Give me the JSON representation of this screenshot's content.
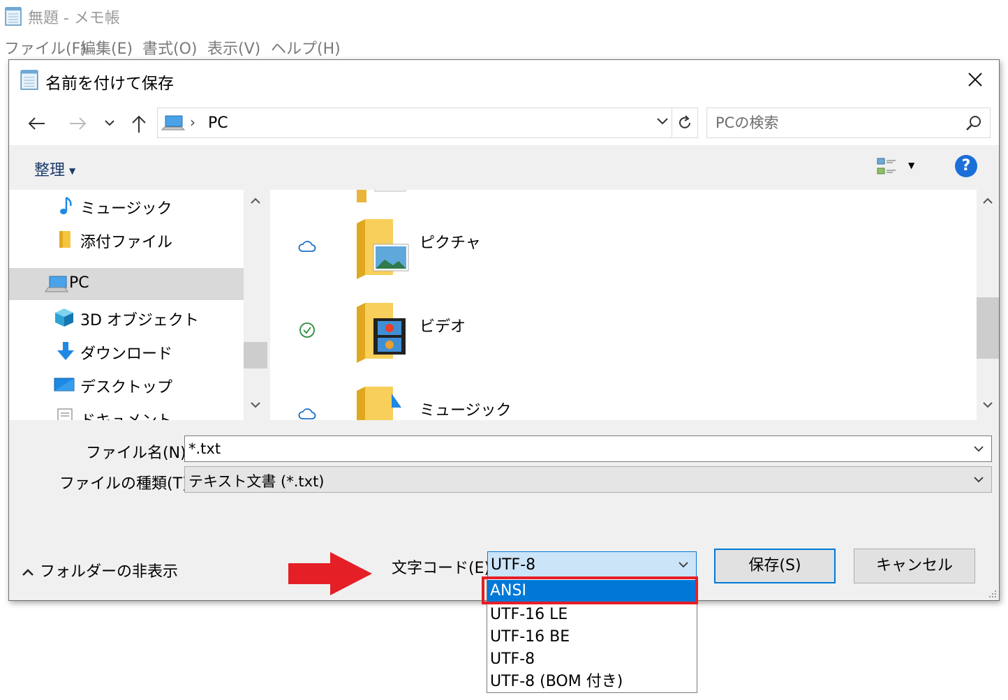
{
  "notepad": {
    "title": "無題 - メモ帳",
    "menu": [
      "ファイル(F)",
      "編集(E)",
      "書式(O)",
      "表示(V)",
      "ヘルプ(H)"
    ]
  },
  "dialog": {
    "title": "名前を付けて保存",
    "address": {
      "path": "PC",
      "separator": "›"
    },
    "search_placeholder": "PCの検索",
    "organize_label": "整理",
    "help_label": "?"
  },
  "nav_pane": {
    "items": [
      {
        "label": "ミュージック",
        "icon": "music-icon",
        "selected": false
      },
      {
        "label": "添付ファイル",
        "icon": "folder-icon",
        "selected": false
      },
      {
        "label": "PC",
        "icon": "pc-icon",
        "selected": true
      },
      {
        "label": "3D オブジェクト",
        "icon": "3d-objects-icon",
        "selected": false
      },
      {
        "label": "ダウンロード",
        "icon": "download-icon",
        "selected": false
      },
      {
        "label": "デスクトップ",
        "icon": "desktop-icon",
        "selected": false
      },
      {
        "label": "ドキュメント",
        "icon": "documents-icon",
        "selected": false
      }
    ]
  },
  "file_pane": {
    "items": [
      {
        "name": "ピクチャ",
        "status": "cloud-icon",
        "icon": "pictures-folder-icon"
      },
      {
        "name": "ビデオ",
        "status": "synced-check-icon",
        "icon": "videos-folder-icon"
      },
      {
        "name": "ミュージック",
        "status": "cloud-icon",
        "icon": "music-folder-icon"
      }
    ]
  },
  "form": {
    "filename_label": "ファイル名(N):",
    "filename_value": "*.txt",
    "filetype_label": "ファイルの種類(T):",
    "filetype_value": "テキスト文書 (*.txt)",
    "hide_folders_label": "フォルダーの非表示",
    "encoding_label": "文字コード(E):",
    "encoding_value": "UTF-8",
    "save_label": "保存(S)",
    "cancel_label": "キャンセル"
  },
  "encoding_options": [
    "ANSI",
    "UTF-16 LE",
    "UTF-16 BE",
    "UTF-8",
    "UTF-8 (BOM 付き)"
  ],
  "highlighted_option": "ANSI",
  "colors": {
    "accent": "#0078d7",
    "annotation_red": "#e41f26",
    "help_blue": "#1c6fd8"
  }
}
